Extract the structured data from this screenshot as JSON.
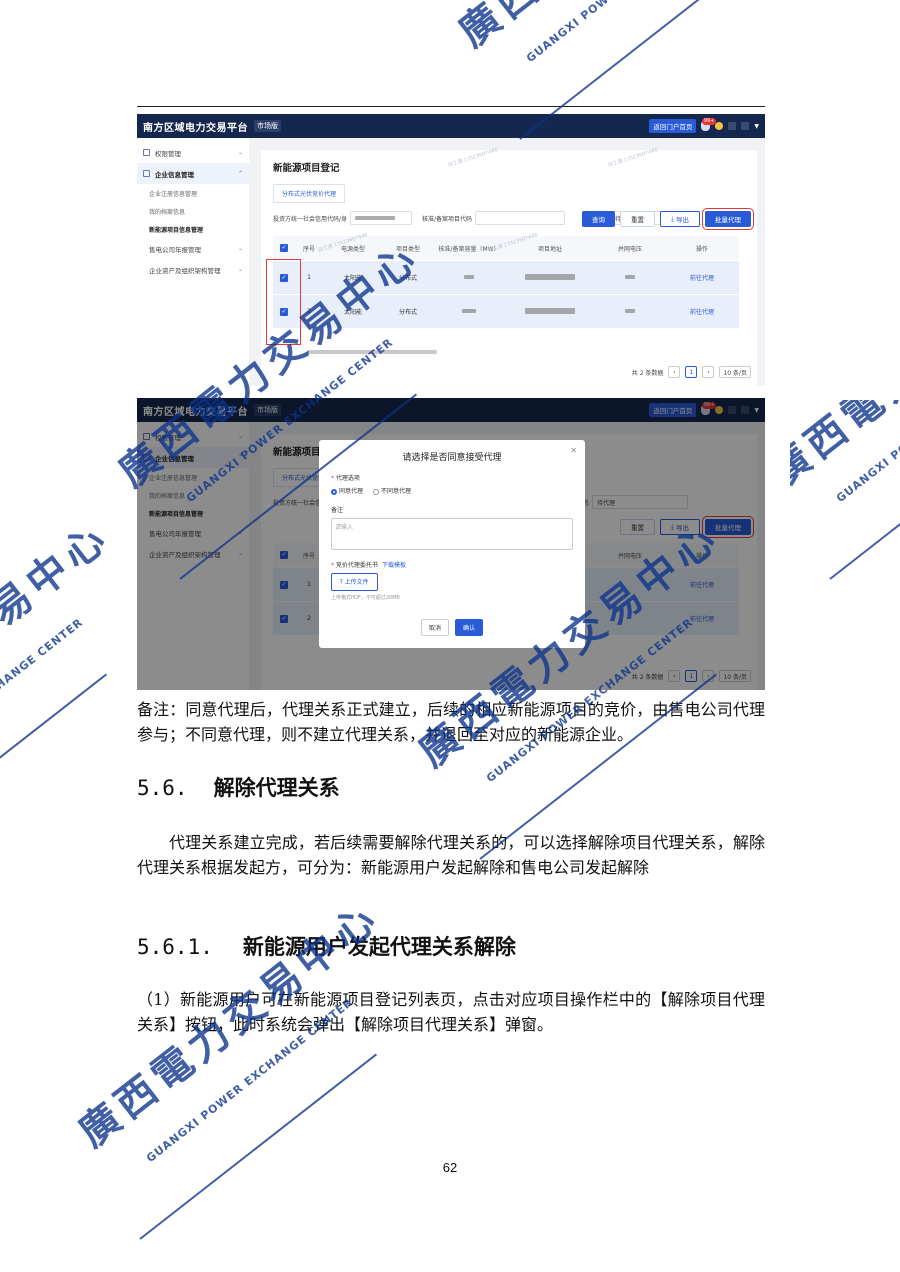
{
  "app": {
    "title": "南方区域电力交易平台",
    "tag": "市场版",
    "home_button": "返回门户首页",
    "bell_badge": "99+"
  },
  "sidebar": {
    "items": [
      {
        "label": "权限管理"
      },
      {
        "label": "企业信息管理"
      },
      {
        "label": "企业注册信息管理"
      },
      {
        "label": "我的档案信息"
      },
      {
        "label": "新能源项目信息管理"
      },
      {
        "label": "售电公司年报管理"
      },
      {
        "label": "企业资产及组织架构管理"
      }
    ]
  },
  "page": {
    "title": "新能源项目登记",
    "subtab": "分布式光伏竞价代理",
    "filter_credit_label": "投资方统一社会信用代码/身",
    "filter_project_label": "核准/备案项目代码",
    "filter_status_label": "代理状态",
    "filter_status_value": "待代理",
    "buttons": {
      "query": "查询",
      "reset": "重置",
      "export": "导出",
      "batch": "批量代理"
    }
  },
  "table": {
    "headers": [
      "序号",
      "电源类型",
      "项目类型",
      "核准/备案容量（MW）",
      "项目地址",
      "并网电压",
      "操作"
    ],
    "rows": [
      {
        "index": "1",
        "power_type": "太阳能",
        "project_type": "分布式",
        "action": "前往代理"
      },
      {
        "index": "2",
        "power_type": "太阳能",
        "project_type": "分布式",
        "action": "前往代理"
      }
    ],
    "pager": {
      "total": "共 2 条数据",
      "current": "1",
      "page_size": "10 条/页"
    }
  },
  "dialog": {
    "title": "请选择是否同意接受代理",
    "agency_label": "代理选项",
    "agree": "同意代理",
    "disagree": "不同意代理",
    "remark_label": "备注",
    "remark_placeholder": "请输入",
    "attorney_label": "竞价代理委托书",
    "download": "下载模板",
    "upload": "上传文件",
    "upload_hint": "上传格式PDF，不可超过20MB",
    "cancel": "取消",
    "confirm": "确认"
  },
  "watermark_small": "何工源 13523607446",
  "doc": {
    "note": "备注：同意代理后，代理关系正式建立，后续的相应新能源项目的竞价，由售电公司代理参与；不同意代理，则不建立代理关系，并退回至对应的新能源企业。",
    "section_num": "5.6.",
    "section_title": "解除代理关系",
    "intro": "代理关系建立完成，若后续需要解除代理关系的，可以选择解除项目代理关系，解除代理关系根据发起方，可分为：新能源用户发起解除和售电公司发起解除",
    "subsection_num": "5.6.1.",
    "subsection_title": "新能源用户发起代理关系解除",
    "step1": "（1）新能源用户可在新能源项目登记列表页，点击对应项目操作栏中的【解除项目代理关系】按钮，此时系统会弹出【解除项目代理关系】弹窗。",
    "page_number": "62"
  },
  "seal": {
    "cn": "廣西電力交易中心",
    "en": "GUANGXI POWER EXCHANGE CENTER"
  },
  "colors": {
    "brand_navy": "#14284f",
    "accent_blue": "#2a5bd7",
    "highlight_red": "#e53935",
    "seal_blue": "#0a328c"
  }
}
